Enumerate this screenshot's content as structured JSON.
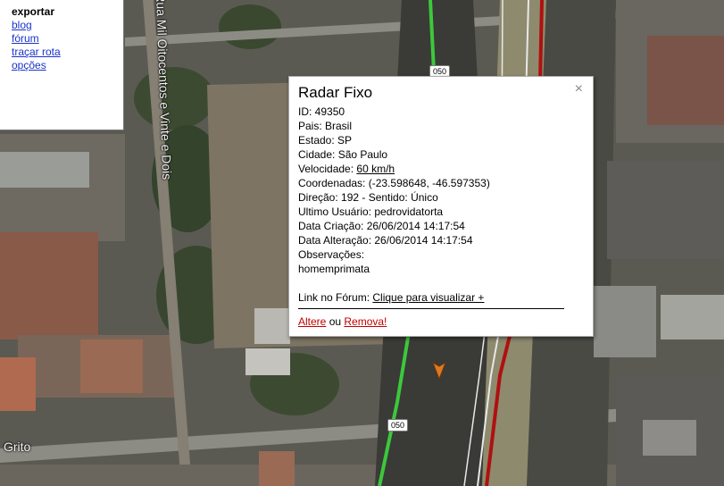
{
  "menu": {
    "heading": "exportar",
    "links": [
      "blog",
      "fórum",
      "traçar rota",
      "opções"
    ]
  },
  "map": {
    "street_vertical": "Rua Mil Oitocentos e Vinte e Dois",
    "street_grito": "Grito",
    "route_shield": "050",
    "icons": [
      "radar-marker-icon",
      "direction-arrow-icon"
    ]
  },
  "info": {
    "title": "Radar Fixo",
    "close_glyph": "×",
    "id": "ID: 49350",
    "pais": "Pais: Brasil",
    "estado": "Estado: SP",
    "cidade": "Cidade: São Paulo",
    "velocidade_label": "Velocidade: ",
    "velocidade_value": "60 km/h",
    "coordenadas": "Coordenadas: (-23.598648, -46.597353)",
    "direcao": "Direção: 192 - Sentido: Único",
    "ultimo_usuario": "Ultimo Usuário: pedrovidatorta",
    "data_criacao": "Data Criação: 26/06/2014 14:17:54",
    "data_alteracao": "Data Alteração: 26/06/2014 14:17:54",
    "observacoes_label": "Observações:",
    "observacoes_value": "homemprimata",
    "forum_label": "Link no Fórum: ",
    "forum_link": "Clique para visualizar +",
    "edit_link": "Altere",
    "or_text": " ou ",
    "remove_link": "Remova!"
  },
  "colors": {
    "link_blue": "#1a33cc",
    "action_red": "#c00000",
    "route_green": "#3cc83c",
    "route_red": "#b01010"
  }
}
